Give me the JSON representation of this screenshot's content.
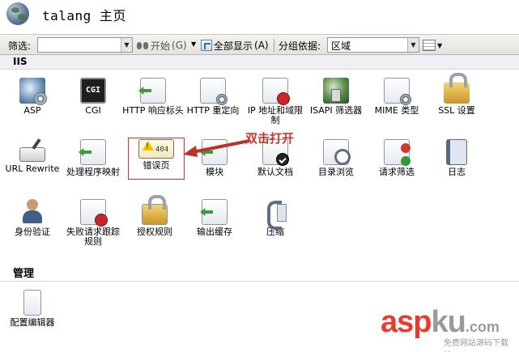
{
  "header": {
    "title": "talang 主页"
  },
  "toolbar": {
    "filter_label": "筛选:",
    "filter_value": "",
    "start_label": "开始",
    "start_shortcut": "(G)",
    "show_all_label": "全部显示",
    "show_all_shortcut": "(A)",
    "group_label": "分组依据:",
    "group_value": "区域"
  },
  "sections": {
    "iis": "IIS",
    "management": "管理"
  },
  "features": {
    "asp": "ASP",
    "cgi": "CGI",
    "http_response_headers": "HTTP 响应标头",
    "http_redirect": "HTTP 重定向",
    "ip_domain_restrictions": "IP 地址和域限制",
    "isapi_filters": "ISAPI 筛选器",
    "mime_types": "MIME 类型",
    "ssl_settings": "SSL 设置",
    "url_rewrite": "URL Rewrite",
    "handler_mappings": "处理程序映射",
    "error_pages": "错误页",
    "modules": "模块",
    "default_document": "默认文档",
    "directory_browsing": "目录浏览",
    "request_filtering": "请求筛选",
    "logging": "日志",
    "authentication": "身份验证",
    "failed_request_tracing": "失败请求跟踪规则",
    "authorization_rules": "授权规则",
    "output_caching": "输出缓存",
    "compression": "压缩",
    "configuration_editor": "配置编辑器"
  },
  "annotation": {
    "text": "双击打开",
    "color": "#c0392b"
  },
  "watermark": {
    "brand_part1": "asp",
    "brand_part2": "ku",
    "brand_suffix": ".com",
    "subtitle": "免费网站源码下载站"
  }
}
